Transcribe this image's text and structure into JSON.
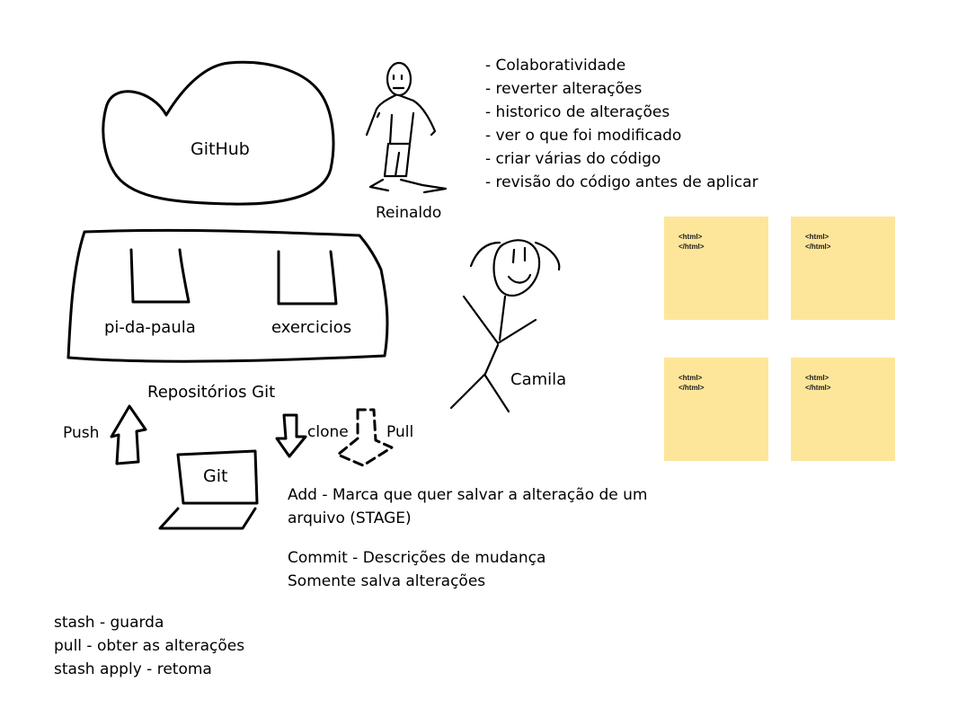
{
  "labels": {
    "github": "GitHub",
    "reinaldo": "Reinaldo",
    "camila": "Camila",
    "repo1": "pi-da-paula",
    "repo2": "exercicios",
    "repos": "Repositórios Git",
    "push": "Push",
    "clone": "clone",
    "pull": "Pull",
    "git": "Git"
  },
  "benefits": [
    "- Colaboratividade",
    "- reverter alterações",
    "- historico de alterações",
    "- ver o que foi modificado",
    "- criar várias do código",
    "- revisão do código antes de aplicar"
  ],
  "add_note": {
    "line1": "Add - Marca que quer salvar a alteração de um",
    "line2": "arquivo (STAGE)"
  },
  "commit_note": {
    "line1": "Commit - Descrições de mudança",
    "line2": "Somente salva alterações"
  },
  "stash_notes": [
    "stash - guarda",
    "pull - obter as alterações",
    "stash apply - retoma"
  ],
  "sticky_notes": [
    {
      "line1": "<html>",
      "line2": "</html>"
    },
    {
      "line1": "<html>",
      "line2": "</html>"
    },
    {
      "line1": "<html>",
      "line2": "</html>"
    },
    {
      "line1": "<html>",
      "line2": "</html>"
    }
  ],
  "colors": {
    "sticky": "#fde69a",
    "ink": "#000000",
    "background": "#ffffff"
  }
}
